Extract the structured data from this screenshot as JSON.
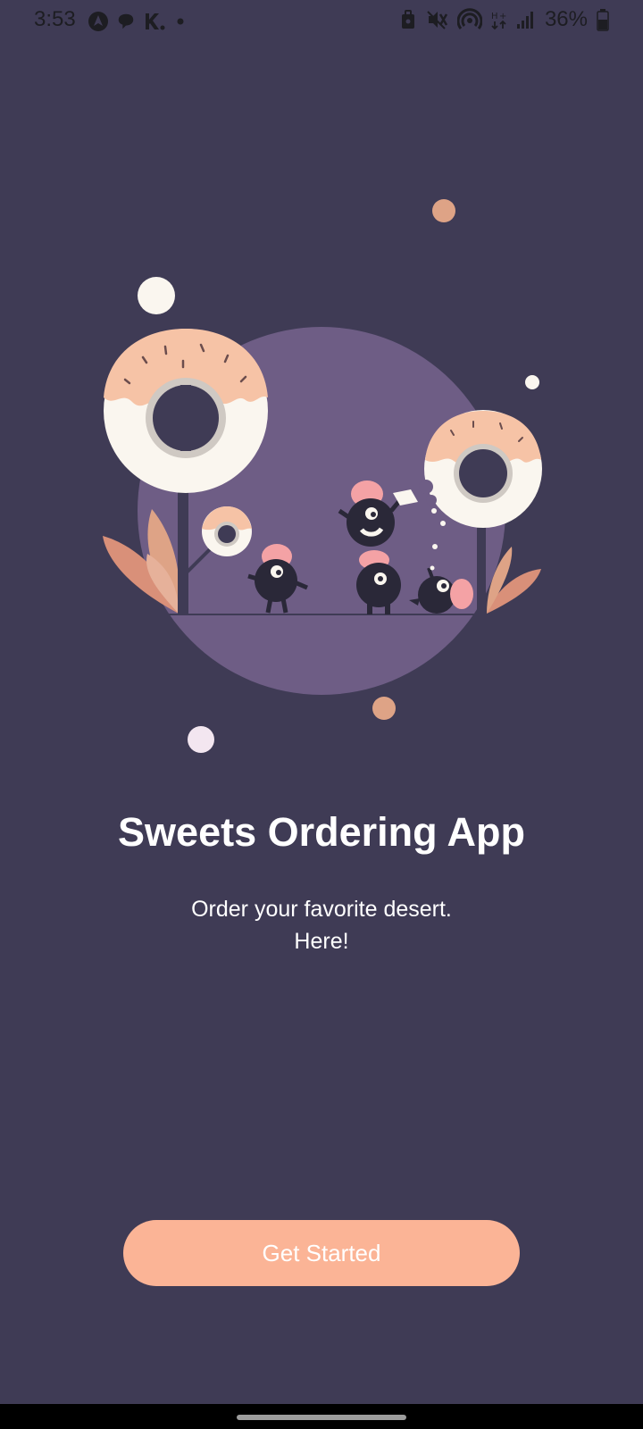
{
  "status_bar": {
    "time": "3:53",
    "battery": "36%",
    "left_icons": [
      "navigation-icon",
      "chat-icon",
      "k-icon",
      "dot-icon"
    ],
    "right_icons": [
      "security-icon",
      "mute-icon",
      "hotspot-icon",
      "data-icon",
      "signal-icon",
      "battery-icon"
    ]
  },
  "onboarding": {
    "title": "Sweets Ordering App",
    "subtitle_line1": "Order your favorite desert.",
    "subtitle_line2": "Here!",
    "button_label": "Get Started"
  },
  "colors": {
    "background": "#3f3b55",
    "circle": "#6e5d85",
    "accent": "#fbb496",
    "donut": "#faf6ef",
    "frosting": "#f6c3a6"
  }
}
